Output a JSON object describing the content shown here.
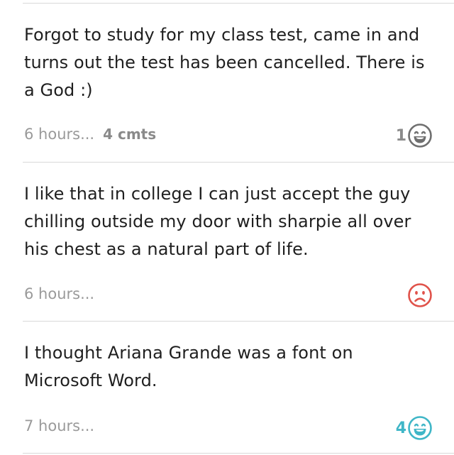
{
  "posts": [
    {
      "text": "Forgot to study for my class test, came in and turns out the test has been cancelled. There is a God :)",
      "time": "6 hours...",
      "comments": "4 cmts",
      "reaction_count": "1",
      "reaction_icon": "laughing-face-icon",
      "reaction_color": "#8a8a8a"
    },
    {
      "text": "I like that in college I can just accept the guy chilling outside my door with sharpie all over his chest as a natural part of life.",
      "time": "6 hours...",
      "comments": "",
      "reaction_count": "",
      "reaction_icon": "sad-face-icon",
      "reaction_color": "#e0524a"
    },
    {
      "text": "I thought Ariana Grande was a font on Microsoft Word.",
      "time": "7 hours...",
      "comments": "",
      "reaction_count": "4",
      "reaction_icon": "laughing-face-icon",
      "reaction_color": "#3fb6c7"
    }
  ]
}
